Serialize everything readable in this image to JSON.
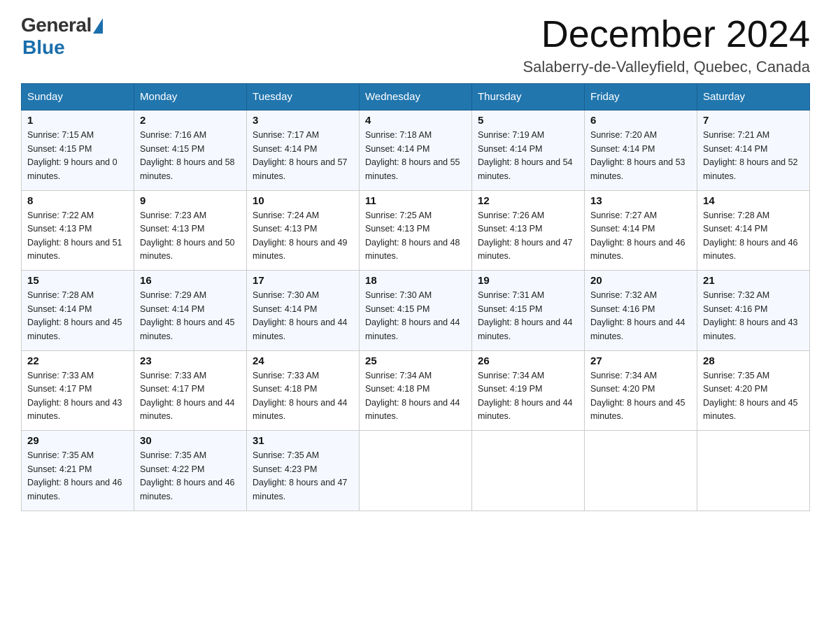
{
  "logo": {
    "general": "General",
    "blue": "Blue"
  },
  "title": "December 2024",
  "subtitle": "Salaberry-de-Valleyfield, Quebec, Canada",
  "headers": [
    "Sunday",
    "Monday",
    "Tuesday",
    "Wednesday",
    "Thursday",
    "Friday",
    "Saturday"
  ],
  "weeks": [
    [
      {
        "day": "1",
        "sunrise": "7:15 AM",
        "sunset": "4:15 PM",
        "daylight": "9 hours and 0 minutes."
      },
      {
        "day": "2",
        "sunrise": "7:16 AM",
        "sunset": "4:15 PM",
        "daylight": "8 hours and 58 minutes."
      },
      {
        "day": "3",
        "sunrise": "7:17 AM",
        "sunset": "4:14 PM",
        "daylight": "8 hours and 57 minutes."
      },
      {
        "day": "4",
        "sunrise": "7:18 AM",
        "sunset": "4:14 PM",
        "daylight": "8 hours and 55 minutes."
      },
      {
        "day": "5",
        "sunrise": "7:19 AM",
        "sunset": "4:14 PM",
        "daylight": "8 hours and 54 minutes."
      },
      {
        "day": "6",
        "sunrise": "7:20 AM",
        "sunset": "4:14 PM",
        "daylight": "8 hours and 53 minutes."
      },
      {
        "day": "7",
        "sunrise": "7:21 AM",
        "sunset": "4:14 PM",
        "daylight": "8 hours and 52 minutes."
      }
    ],
    [
      {
        "day": "8",
        "sunrise": "7:22 AM",
        "sunset": "4:13 PM",
        "daylight": "8 hours and 51 minutes."
      },
      {
        "day": "9",
        "sunrise": "7:23 AM",
        "sunset": "4:13 PM",
        "daylight": "8 hours and 50 minutes."
      },
      {
        "day": "10",
        "sunrise": "7:24 AM",
        "sunset": "4:13 PM",
        "daylight": "8 hours and 49 minutes."
      },
      {
        "day": "11",
        "sunrise": "7:25 AM",
        "sunset": "4:13 PM",
        "daylight": "8 hours and 48 minutes."
      },
      {
        "day": "12",
        "sunrise": "7:26 AM",
        "sunset": "4:13 PM",
        "daylight": "8 hours and 47 minutes."
      },
      {
        "day": "13",
        "sunrise": "7:27 AM",
        "sunset": "4:14 PM",
        "daylight": "8 hours and 46 minutes."
      },
      {
        "day": "14",
        "sunrise": "7:28 AM",
        "sunset": "4:14 PM",
        "daylight": "8 hours and 46 minutes."
      }
    ],
    [
      {
        "day": "15",
        "sunrise": "7:28 AM",
        "sunset": "4:14 PM",
        "daylight": "8 hours and 45 minutes."
      },
      {
        "day": "16",
        "sunrise": "7:29 AM",
        "sunset": "4:14 PM",
        "daylight": "8 hours and 45 minutes."
      },
      {
        "day": "17",
        "sunrise": "7:30 AM",
        "sunset": "4:14 PM",
        "daylight": "8 hours and 44 minutes."
      },
      {
        "day": "18",
        "sunrise": "7:30 AM",
        "sunset": "4:15 PM",
        "daylight": "8 hours and 44 minutes."
      },
      {
        "day": "19",
        "sunrise": "7:31 AM",
        "sunset": "4:15 PM",
        "daylight": "8 hours and 44 minutes."
      },
      {
        "day": "20",
        "sunrise": "7:32 AM",
        "sunset": "4:16 PM",
        "daylight": "8 hours and 44 minutes."
      },
      {
        "day": "21",
        "sunrise": "7:32 AM",
        "sunset": "4:16 PM",
        "daylight": "8 hours and 43 minutes."
      }
    ],
    [
      {
        "day": "22",
        "sunrise": "7:33 AM",
        "sunset": "4:17 PM",
        "daylight": "8 hours and 43 minutes."
      },
      {
        "day": "23",
        "sunrise": "7:33 AM",
        "sunset": "4:17 PM",
        "daylight": "8 hours and 44 minutes."
      },
      {
        "day": "24",
        "sunrise": "7:33 AM",
        "sunset": "4:18 PM",
        "daylight": "8 hours and 44 minutes."
      },
      {
        "day": "25",
        "sunrise": "7:34 AM",
        "sunset": "4:18 PM",
        "daylight": "8 hours and 44 minutes."
      },
      {
        "day": "26",
        "sunrise": "7:34 AM",
        "sunset": "4:19 PM",
        "daylight": "8 hours and 44 minutes."
      },
      {
        "day": "27",
        "sunrise": "7:34 AM",
        "sunset": "4:20 PM",
        "daylight": "8 hours and 45 minutes."
      },
      {
        "day": "28",
        "sunrise": "7:35 AM",
        "sunset": "4:20 PM",
        "daylight": "8 hours and 45 minutes."
      }
    ],
    [
      {
        "day": "29",
        "sunrise": "7:35 AM",
        "sunset": "4:21 PM",
        "daylight": "8 hours and 46 minutes."
      },
      {
        "day": "30",
        "sunrise": "7:35 AM",
        "sunset": "4:22 PM",
        "daylight": "8 hours and 46 minutes."
      },
      {
        "day": "31",
        "sunrise": "7:35 AM",
        "sunset": "4:23 PM",
        "daylight": "8 hours and 47 minutes."
      },
      null,
      null,
      null,
      null
    ]
  ]
}
